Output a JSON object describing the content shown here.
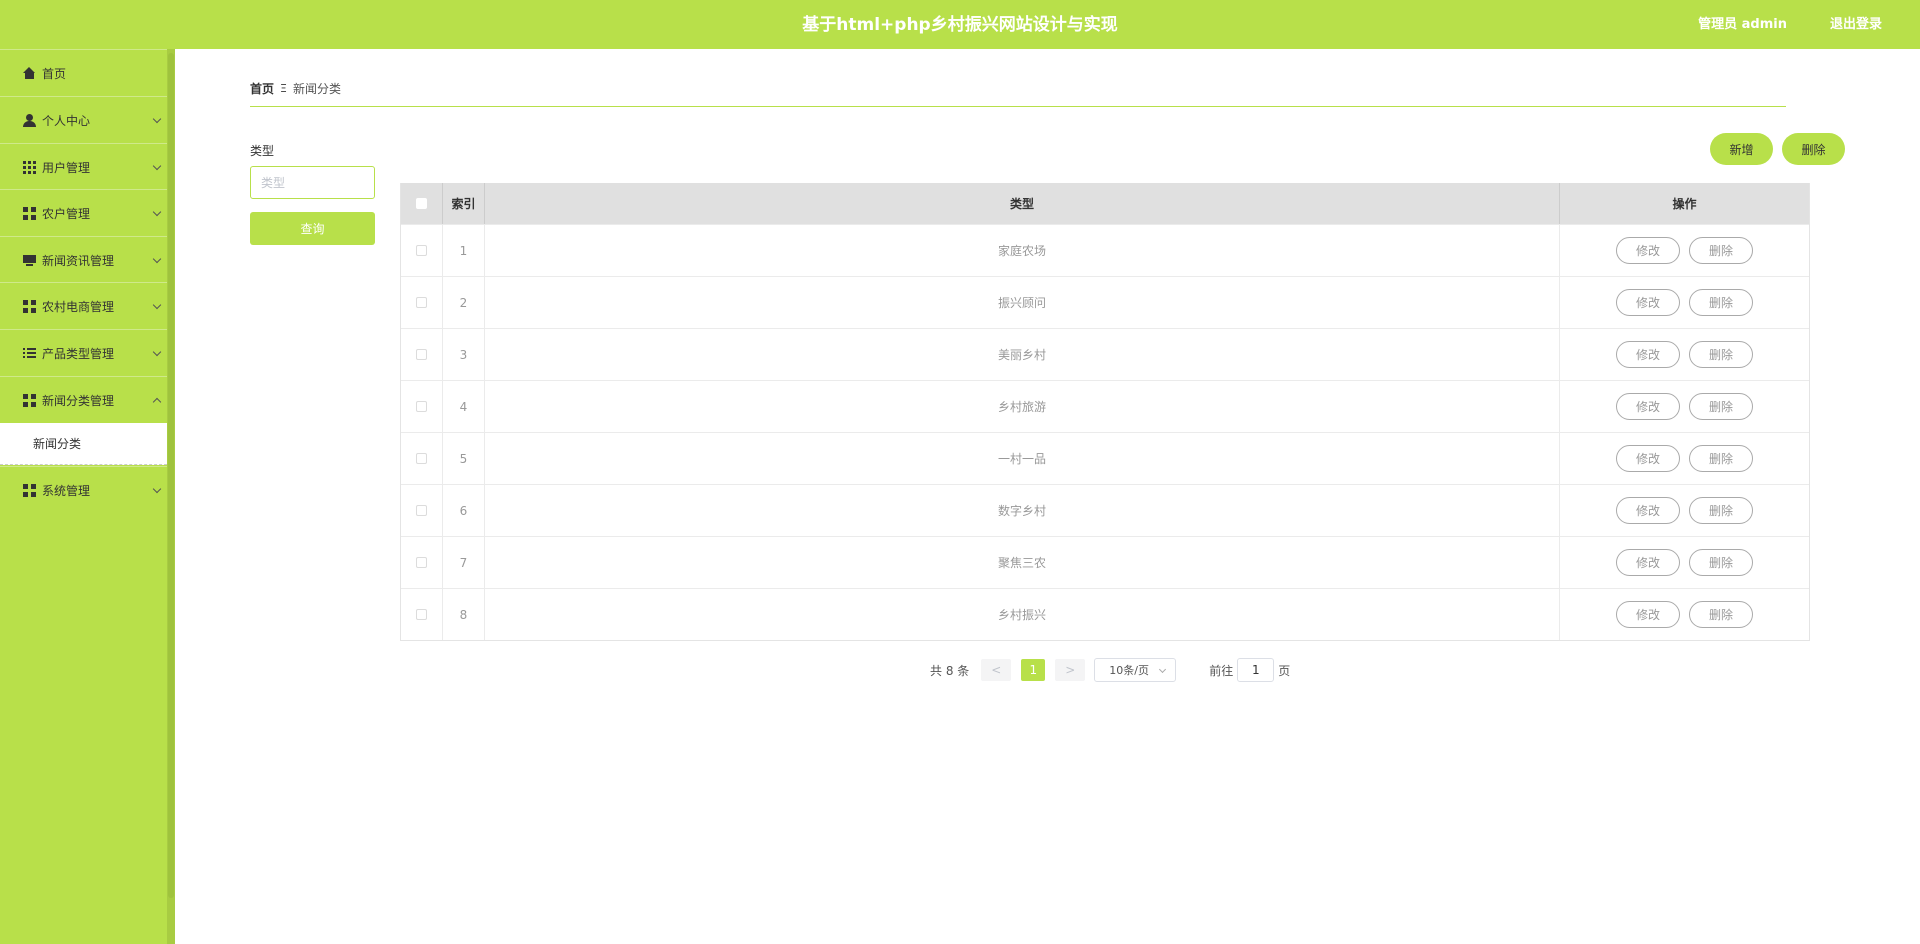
{
  "header": {
    "title": "基于html+php乡村振兴网站设计与实现",
    "user": "管理员 admin",
    "logout": "退出登录",
    "accent_color": "#b8e04a"
  },
  "sidebar": {
    "items": [
      {
        "label": "首页",
        "icon": "home-icon"
      },
      {
        "label": "个人中心",
        "icon": "user-icon"
      },
      {
        "label": "用户管理",
        "icon": "grid-icon"
      },
      {
        "label": "农户管理",
        "icon": "grid-icon"
      },
      {
        "label": "新闻资讯管理",
        "icon": "monitor-icon"
      },
      {
        "label": "农村电商管理",
        "icon": "grid-icon"
      },
      {
        "label": "产品类型管理",
        "icon": "list-icon"
      },
      {
        "label": "新闻分类管理",
        "icon": "grid-icon",
        "expanded": true
      },
      {
        "label": "系统管理",
        "icon": "grid-icon"
      }
    ],
    "submenu": {
      "label": "新闻分类"
    }
  },
  "breadcrumb": {
    "home": "首页",
    "separator": "Ξ",
    "current": "新闻分类"
  },
  "filter": {
    "label": "类型",
    "placeholder": "类型",
    "query_label": "查询"
  },
  "actions": {
    "add_label": "新增",
    "delete_label": "删除"
  },
  "table": {
    "headers": {
      "index": "索引",
      "type": "类型",
      "ops": "操作"
    },
    "edit_label": "修改",
    "delete_label": "删除",
    "rows": [
      {
        "index": "1",
        "type": "家庭农场"
      },
      {
        "index": "2",
        "type": "振兴顾问"
      },
      {
        "index": "3",
        "type": "美丽乡村"
      },
      {
        "index": "4",
        "type": "乡村旅游"
      },
      {
        "index": "5",
        "type": "一村一品"
      },
      {
        "index": "6",
        "type": "数字乡村"
      },
      {
        "index": "7",
        "type": "聚焦三农"
      },
      {
        "index": "8",
        "type": "乡村振兴"
      }
    ]
  },
  "pagination": {
    "total": "共 8 条",
    "prev": "<",
    "page": "1",
    "next": ">",
    "page_size": "10条/页",
    "goto_label": "前往",
    "goto_value": "1",
    "goto_unit": "页"
  }
}
